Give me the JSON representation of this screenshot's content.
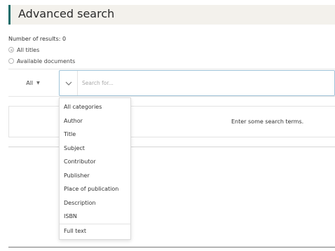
{
  "header": {
    "title": "Advanced search"
  },
  "results_count": "Number of results: 0",
  "filter": {
    "options": [
      {
        "label": "All titles",
        "selected": true
      },
      {
        "label": "Available documents",
        "selected": false
      }
    ]
  },
  "search": {
    "category_selected": "All",
    "placeholder": "Search for..."
  },
  "results_panel": {
    "message": "Enter some search terms."
  },
  "category_menu": {
    "items": [
      "All categories",
      "Author",
      "Title",
      "Subject",
      "Contributor",
      "Publisher",
      "Place of publication",
      "Description",
      "ISBN",
      "Full text"
    ]
  },
  "colors": {
    "accent": "#1f6d6b",
    "header_bg": "#f3f1ec",
    "focus_border": "#9fc3d8"
  },
  "icons": {
    "category_caret": "caret-down-icon",
    "search_dropdown": "chevron-down-icon"
  }
}
